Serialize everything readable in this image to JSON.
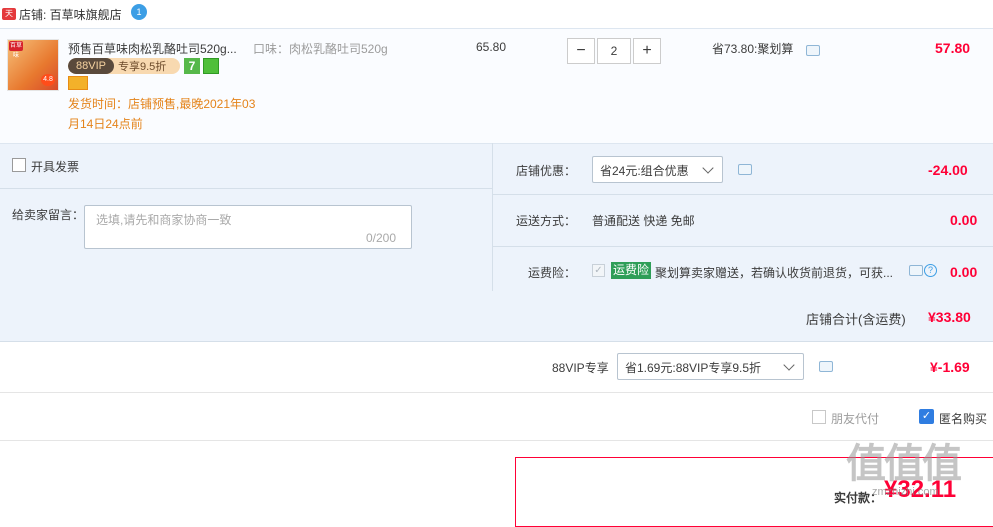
{
  "shop": {
    "badge": "天猫",
    "label": "店铺: 百草味旗舰店",
    "chat_badge": "1"
  },
  "item": {
    "title": "预售百草味肉松乳酪吐司520g...",
    "sku": "口味：肉松乳酪吐司520g",
    "thumb_brand": "百草味",
    "thumb_tag": "4.8",
    "vip_88": "88VIP",
    "vip_text": "专享9.5折",
    "badge_7": "7",
    "ship_time": "发货时间：店铺预售,最晚2021年03月14日24点前",
    "unit_price": "65.80",
    "qty": "2",
    "qty_minus": "−",
    "qty_plus": "+",
    "save_info": "省73.80:聚划算",
    "subtotal": "57.80"
  },
  "options": {
    "invoice_label": "开具发票",
    "message_label": "给卖家留言：",
    "message_placeholder": "选填,请先和商家协商一致",
    "message_count": "0/200",
    "discount_label": "店铺优惠：",
    "discount_select": "省24元:组合优惠",
    "discount_value": "-24.00",
    "shipping_label": "运送方式：",
    "shipping_text": "普通配送 快递 免邮",
    "shipping_value": "0.00",
    "insurance_label": "运费险：",
    "insurance_badge": "运费险",
    "insurance_text": "聚划算卖家赠送，若确认收货前退货，可获...",
    "insurance_value": "0.00",
    "help": "?"
  },
  "shop_total": {
    "label": "店铺合计(含运费)",
    "value": "¥33.80"
  },
  "vip": {
    "label": "88VIP专享",
    "select": "省1.69元:88VIP专享9.5折",
    "value": "¥-1.69"
  },
  "checks": {
    "friend_label": "朋友代付",
    "anon_label": "匿名购买",
    "checkmark": "✓"
  },
  "pay": {
    "label": "实付款：",
    "amount": "¥32.11"
  },
  "watermark": {
    "logo": "值值值",
    "site": "zmzhizhi.com"
  }
}
